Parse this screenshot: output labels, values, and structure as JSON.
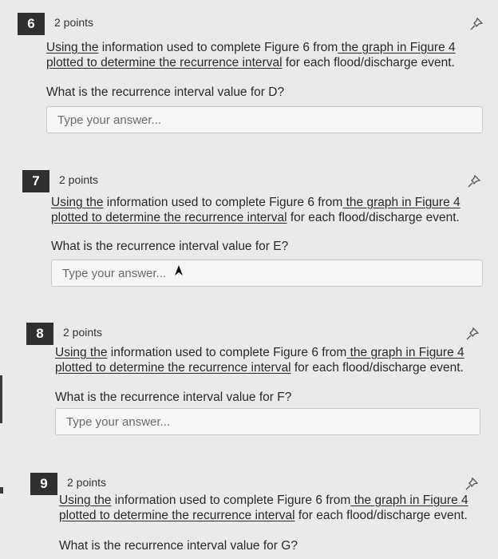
{
  "questions": [
    {
      "number": "6",
      "points": "2 points",
      "instr_parts": [
        "Using the",
        " information used to complete Figure 6 from",
        " the graph in Figure 4 plotted to determine the recurrence interval",
        " for each flood/discharge event."
      ],
      "question": "What is the recurrence interval value for D?",
      "placeholder": "Type your answer..."
    },
    {
      "number": "7",
      "points": "2 points",
      "instr_parts": [
        "Using the",
        " information used to complete Figure 6 from",
        " the graph in Figure 4 plotted to determine the recurrence interval",
        " for each flood/discharge event."
      ],
      "question": "What is the recurrence interval value for E?",
      "placeholder": "Type your answer..."
    },
    {
      "number": "8",
      "points": "2 points",
      "instr_parts": [
        "Using the",
        " information used to complete Figure 6 from",
        " the graph in Figure 4 plotted to determine the recurrence interval",
        " for each flood/discharge event."
      ],
      "question": "What is the recurrence interval value for F?",
      "placeholder": "Type your answer..."
    },
    {
      "number": "9",
      "points": "2 points",
      "instr_parts": [
        "Using the",
        " information used to complete Figure 6 from",
        " the graph in Figure 4 plotted to determine the recurrence interval",
        " for each flood/discharge event."
      ],
      "question": "What is the recurrence interval value for G?",
      "placeholder": ""
    }
  ],
  "icons": {
    "pin": "pin-icon",
    "cursor": "mouse-cursor-icon"
  },
  "colors": {
    "number_badge": "#2f2f2f",
    "page_bg": "#e9eaec",
    "input_bg": "#f6f6f7"
  }
}
